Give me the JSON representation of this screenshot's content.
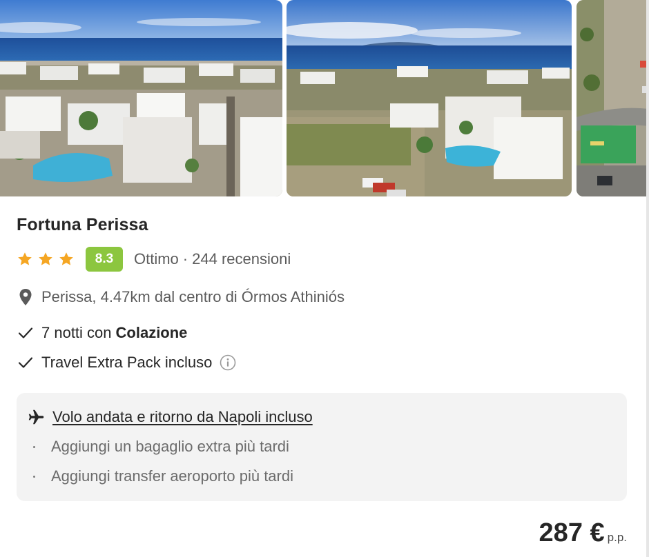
{
  "hotel": {
    "name": "Fortuna Perissa",
    "stars": 3,
    "score": "8.3",
    "rating_label": "Ottimo",
    "reviews": "244 recensioni",
    "location": "Perissa, 4.47km dal centro di Órmos Athiniós"
  },
  "features": {
    "nights_prefix": "7 notti con",
    "board": "Colazione",
    "extra_pack": "Travel Extra Pack incluso"
  },
  "flight": {
    "title": "Volo andata e ritorno da Napoli incluso",
    "options": [
      "Aggiungi un bagaglio extra più tardi",
      "Aggiungi transfer aeroporto più tardi"
    ]
  },
  "price": {
    "amount": "287 €",
    "per": "p.p."
  },
  "icons": {
    "star": "star-icon",
    "pin": "location-pin-icon",
    "check": "check-icon",
    "info": "info-icon",
    "plane": "plane-icon"
  },
  "colors": {
    "score_badge": "#8cc63f",
    "star": "#f5a623",
    "flight_box": "#f3f3f3"
  },
  "gallery": {
    "photos": [
      "aerial-view-hotel-sea",
      "aerial-view-hotel-village",
      "aerial-view-parking-garden"
    ]
  }
}
